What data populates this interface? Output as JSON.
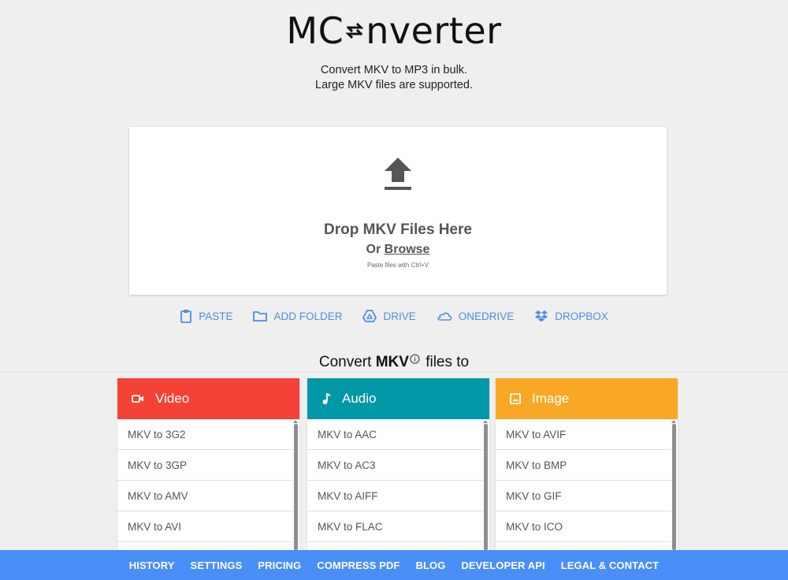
{
  "header": {
    "logo_left": "MC",
    "logo_right": "nverter",
    "tagline_line1": "Convert MKV to MP3 in bulk.",
    "tagline_line2": "Large MKV files are supported."
  },
  "dropzone": {
    "title": "Drop MKV Files Here",
    "or_label": "Or",
    "browse_label": "Browse",
    "hint": "Paste files with Ctrl+V"
  },
  "sources": [
    {
      "label": "PASTE",
      "icon": "clipboard-icon"
    },
    {
      "label": "ADD FOLDER",
      "icon": "folder-icon"
    },
    {
      "label": "DRIVE",
      "icon": "google-drive-icon"
    },
    {
      "label": "ONEDRIVE",
      "icon": "onedrive-icon"
    },
    {
      "label": "DROPBOX",
      "icon": "dropbox-icon"
    }
  ],
  "convert": {
    "prefix": "Convert",
    "format": "MKV",
    "suffix": "files to"
  },
  "categories": [
    {
      "title": "Video",
      "icon": "video-camera-icon",
      "color": "#f44336",
      "items": [
        "MKV to 3G2",
        "MKV to 3GP",
        "MKV to AMV",
        "MKV to AVI"
      ]
    },
    {
      "title": "Audio",
      "icon": "music-note-icon",
      "color": "#0097a7",
      "items": [
        "MKV to AAC",
        "MKV to AC3",
        "MKV to AIFF",
        "MKV to FLAC"
      ]
    },
    {
      "title": "Image",
      "icon": "image-icon",
      "color": "#f9a825",
      "items": [
        "MKV to AVIF",
        "MKV to BMP",
        "MKV to GIF",
        "MKV to ICO"
      ]
    }
  ],
  "footer": {
    "links": [
      "HISTORY",
      "SETTINGS",
      "PRICING",
      "COMPRESS PDF",
      "BLOG",
      "DEVELOPER API",
      "LEGAL & CONTACT"
    ],
    "color": "#4a8ef7"
  },
  "colors": {
    "accent_link": "#4a8fe6",
    "background": "#efefef"
  }
}
